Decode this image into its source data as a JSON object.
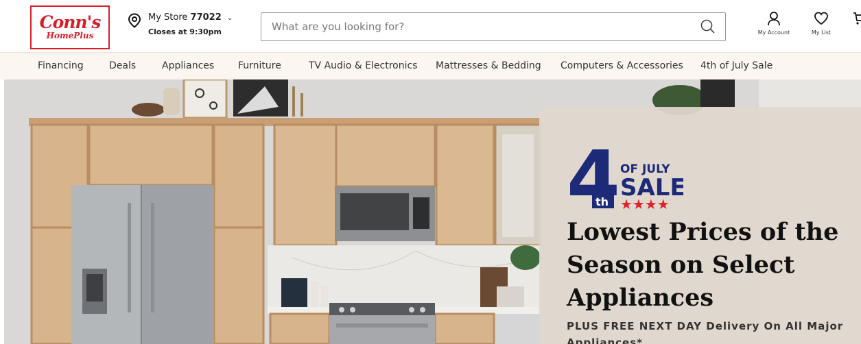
{
  "logo": {
    "main": "Conn's",
    "sub": "HomePlus"
  },
  "store": {
    "label": "My Store",
    "number": "77022",
    "hours": "Closes at 9:30pm"
  },
  "search": {
    "placeholder": "What are you looking for?"
  },
  "account": {
    "my_account": "My Account",
    "my_list": "My List"
  },
  "nav": {
    "items": [
      "Financing",
      "Deals",
      "Appliances",
      "Furniture",
      "TV Audio & Electronics",
      "Mattresses & Bedding",
      "Computers & Accessories",
      "4th of July Sale"
    ]
  },
  "promo": {
    "badge_number": "4",
    "badge_suffix": "th",
    "badge_line1": "OF JULY",
    "badge_line2": "SALE",
    "heading": "Lowest Prices of the Season on Select Appliances",
    "subtext": "PLUS FREE NEXT DAY Delivery On All Major Appliances*"
  },
  "colors": {
    "brand_red": "#d81e28",
    "badge_navy": "#1c2a78",
    "badge_red": "#e0202a",
    "nav_bg": "#fcf6f0"
  }
}
